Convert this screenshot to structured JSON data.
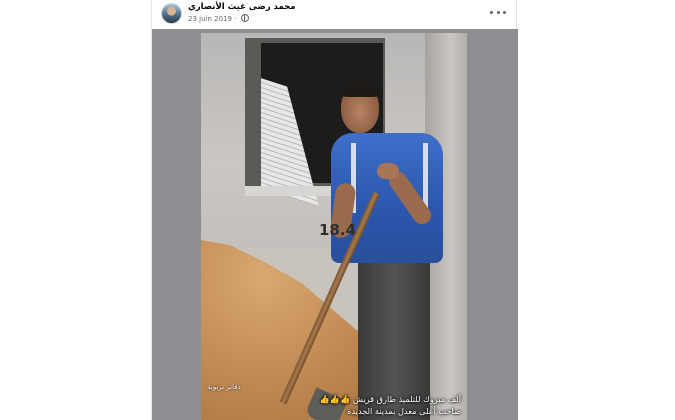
{
  "post": {
    "author": "محمد رضى غيث الأنصاري",
    "date": "23 juin 2019",
    "audience_icon": "globe-icon",
    "more_icon": "more-options-icon"
  },
  "photo": {
    "watermark": "18.4",
    "credit": "دفاتر تربوية",
    "caption_line1": "ألف مبروك للتلميذ طارق قريش 👍👍👍",
    "caption_line2": "صاحب أعلى معدل بمدينة الجديدة"
  },
  "colors": {
    "card_background": "#ffffff",
    "media_background": "#8e8f93",
    "secondary_text": "#65676b"
  }
}
